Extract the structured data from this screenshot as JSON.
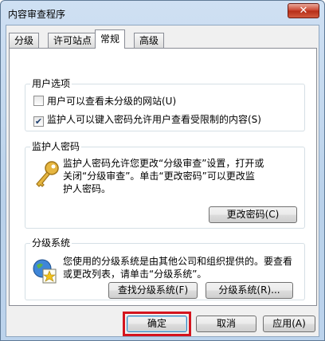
{
  "window": {
    "title": "内容审查程序",
    "close_label": "✕"
  },
  "tabs": [
    {
      "label": "分级",
      "active": false
    },
    {
      "label": "许可站点",
      "active": false
    },
    {
      "label": "常规",
      "active": true
    },
    {
      "label": "高级",
      "active": false
    }
  ],
  "user_options": {
    "title": "用户选项",
    "checkbox1": {
      "label": "用户可以查看未分级的网站(U)",
      "checked": false
    },
    "checkbox2": {
      "label": "监护人可以键入密码允许用户查看受限制的内容(S)",
      "checked": true
    }
  },
  "supervisor": {
    "title": "监护人密码",
    "desc_line1": "监护人密码允许您更改“分级审查”设置，打开或",
    "desc_line2": "关闭“分级审查”。单击“更改密码”可以更改监",
    "desc_line3": "护人密码。",
    "change_password_label": "更改密码(C)"
  },
  "rating_systems": {
    "title": "分级系统",
    "desc_line1": "您使用的分级系统是由其他公司和组织提供的。要查看",
    "desc_line2": "或更改列表，请单击“分级系统”。",
    "find_label": "查找分级系统(F)",
    "systems_label": "分级系统(R)..."
  },
  "footer": {
    "ok_label": "确定",
    "cancel_label": "取消",
    "apply_label": "应用(A)"
  },
  "colors": {
    "highlight": "#d4141e",
    "accent": "#3c7fb1"
  }
}
